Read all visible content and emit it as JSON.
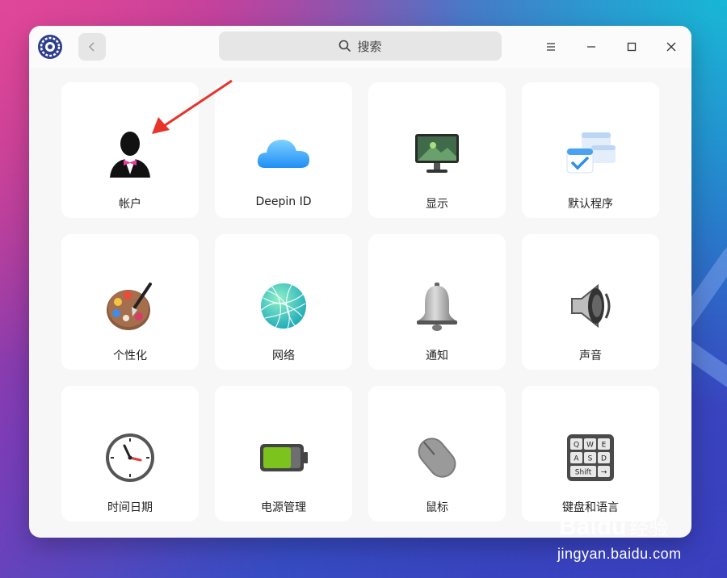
{
  "window": {
    "search_placeholder": "搜索"
  },
  "modules": [
    {
      "label": "帐户",
      "icon": "account-icon"
    },
    {
      "label": "Deepin ID",
      "icon": "cloud-icon"
    },
    {
      "label": "显示",
      "icon": "display-icon"
    },
    {
      "label": "默认程序",
      "icon": "default-apps-icon"
    },
    {
      "label": "个性化",
      "icon": "palette-icon"
    },
    {
      "label": "网络",
      "icon": "network-icon"
    },
    {
      "label": "通知",
      "icon": "bell-icon"
    },
    {
      "label": "声音",
      "icon": "speaker-icon"
    },
    {
      "label": "时间日期",
      "icon": "clock-icon"
    },
    {
      "label": "电源管理",
      "icon": "battery-icon"
    },
    {
      "label": "鼠标",
      "icon": "mouse-icon"
    },
    {
      "label": "键盘和语言",
      "icon": "keyboard-icon"
    }
  ],
  "keyboard_keys": [
    "Q",
    "W",
    "E",
    "A",
    "S",
    "D",
    "Shift",
    "→"
  ],
  "watermark": {
    "logo": "Bai",
    "logo_suffix": "du",
    "logo_cn": "经验",
    "url": "jingyan.baidu.com"
  },
  "colors": {
    "accent": "#2ca7f8",
    "annotation_arrow": "#e8332a"
  }
}
